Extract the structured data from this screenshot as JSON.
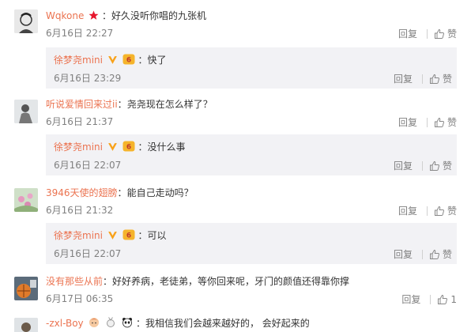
{
  "ui": {
    "reply_label": "回复",
    "like_label": "赞",
    "colon": "："
  },
  "comments": [
    {
      "user": "Wqkone",
      "text": "好久没听你唱的九张机",
      "time": "6月16日 22:27",
      "like_text": "赞",
      "reply": {
        "user": "徐梦尧mini",
        "text": "快了",
        "time": "6月16日 23:29",
        "like_text": "赞"
      }
    },
    {
      "user": "听说爱情回来过ii",
      "text": "尧尧现在怎么样了？",
      "time": "6月16日 21:37",
      "like_text": "赞",
      "reply": {
        "user": "徐梦尧mini",
        "text": "没什么事",
        "time": "6月16日 22:07",
        "like_text": "赞"
      }
    },
    {
      "user": "3946天使的翅膀",
      "text": "能自己走动吗？",
      "time": "6月16日 21:32",
      "like_text": "赞",
      "reply": {
        "user": "徐梦尧mini",
        "text": "可以",
        "time": "6月16日 22:07",
        "like_text": "赞"
      }
    },
    {
      "user": "没有那些从前",
      "text": "好好养病，老徒弟，等你回来呢，牙门的颜值还得靠你撑",
      "time": "6月17日 06:35",
      "like_text": "1"
    },
    {
      "user": "-zxl-Boy",
      "text": "我相信我们会越来越好的， 会好起来的"
    }
  ]
}
